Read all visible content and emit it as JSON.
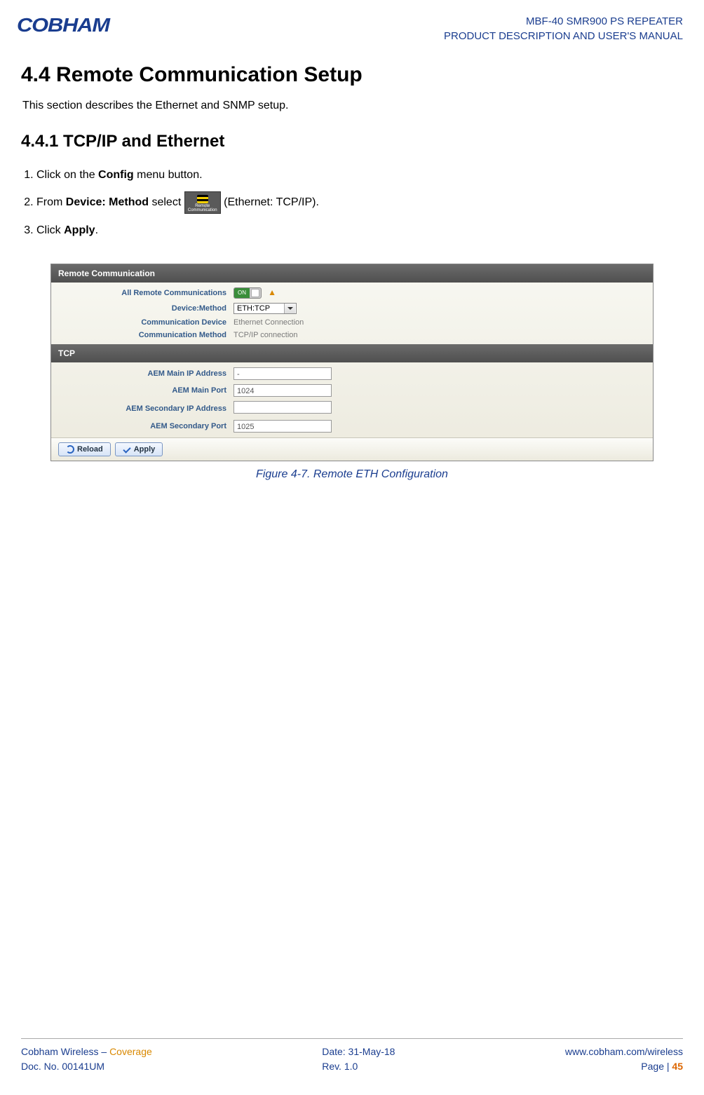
{
  "header": {
    "logo_text": "COBHAM",
    "line1": "MBF-40 SMR900 PS REPEATER",
    "line2": "PRODUCT DESCRIPTION AND USER'S MANUAL"
  },
  "section_title": "4.4   Remote Communication Setup",
  "section_intro": "This section describes the Ethernet and SNMP setup.",
  "subsection_title": "4.4.1  TCP/IP and Ethernet",
  "steps": {
    "s1_pre": "Click on the ",
    "s1_bold": "Config",
    "s1_post": " menu button.",
    "s2_pre": "From ",
    "s2_bold": "Device: Method",
    "s2_mid": " select ",
    "s2_iconlabel": "Remote\nCommunication",
    "s2_post": " (Ethernet: TCP/IP).",
    "s3_pre": "Click ",
    "s3_bold": "Apply",
    "s3_post": "."
  },
  "screenshot": {
    "panel1_title": "Remote Communication",
    "rows1": {
      "r1_label": "All Remote Communications",
      "r1_on": "ON",
      "r2_label": "Device:Method",
      "r2_value": "ETH:TCP",
      "r3_label": "Communication Device",
      "r3_value": "Ethernet Connection",
      "r4_label": "Communication Method",
      "r4_value": "TCP/IP connection"
    },
    "panel2_title": "TCP",
    "rows2": {
      "r1_label": "AEM Main IP Address",
      "r1_value": "-",
      "r2_label": "AEM Main Port",
      "r2_value": "1024",
      "r3_label": "AEM Secondary IP Address",
      "r3_value": "",
      "r4_label": "AEM Secondary Port",
      "r4_value": "1025"
    },
    "btn_reload": "Reload",
    "btn_apply": "Apply"
  },
  "figure_caption": "Figure 4-7.  Remote ETH Configuration",
  "footer": {
    "l1a": "Cobham Wireless",
    "l1sep": " – ",
    "l1b": "Coverage",
    "l2": "Doc. No. 00141UM",
    "m1": "Date: 31-May-18",
    "m2": "Rev. 1.0",
    "r1": "www.cobham.com/wireless",
    "r2_pre": "Page | ",
    "r2_num": "45"
  }
}
